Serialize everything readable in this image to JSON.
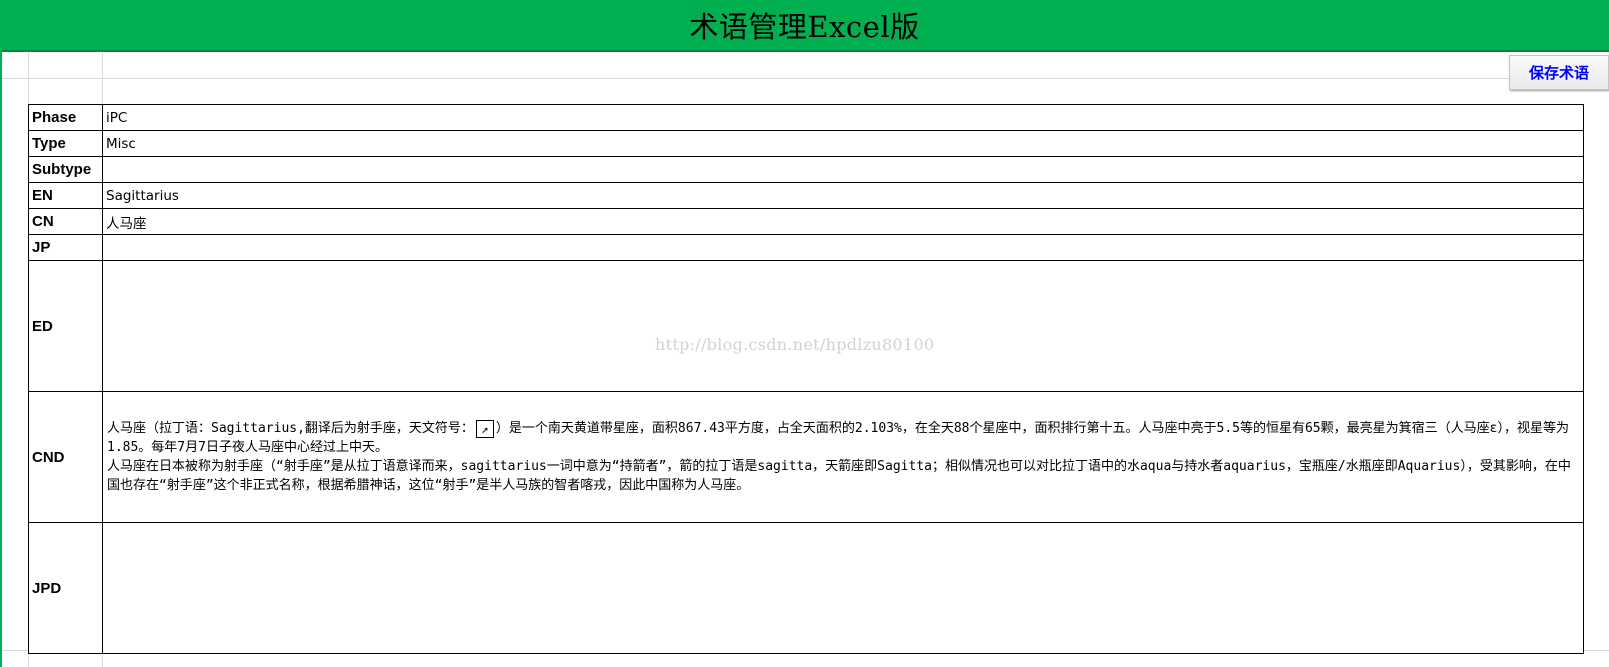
{
  "window": {
    "title": "术语管理Excel版"
  },
  "toolbar": {
    "save_label": "保存术语"
  },
  "fields": [
    {
      "label": "Phase",
      "value": "iPC"
    },
    {
      "label": "Type",
      "value": "Misc"
    },
    {
      "label": "Subtype",
      "value": ""
    },
    {
      "label": "EN",
      "value": "Sagittarius"
    },
    {
      "label": "CN",
      "value": "人马座"
    },
    {
      "label": "JP",
      "value": ""
    },
    {
      "label": "ED",
      "value": ""
    },
    {
      "label": "CND",
      "value_part1": "人马座（拉丁语：Sagittarius,翻译后为射手座，天文符号：",
      "symbol": "↗",
      "value_part2": "）是一个南天黄道带星座，面积867.43平方度，占全天面积的2.103%，在全天88个星座中，面积排行第十五。人马座中亮于5.5等的恒星有65颗，最亮星为箕宿三（人马座ε），视星等为1.85。每年7月7日子夜人马座中心经过上中天。",
      "value_para2": "人马座在日本被称为射手座（“射手座”是从拉丁语意译而来，sagittarius一词中意为“持箭者”，箭的拉丁语是sagitta，天箭座即Sagitta；相似情况也可以对比拉丁语中的水aqua与持水者aquarius，宝瓶座/水瓶座即Aquarius），受其影响，在中国也存在“射手座”这个非正式名称，根据希腊神话，这位“射手”是半人马族的智者喀戎，因此中国称为人马座。"
    },
    {
      "label": "JPD",
      "value": ""
    }
  ],
  "watermark": "http://blog.csdn.net/hpdlzu80100",
  "colors": {
    "title_bar": "#00b050",
    "button_text": "#0000ff"
  }
}
